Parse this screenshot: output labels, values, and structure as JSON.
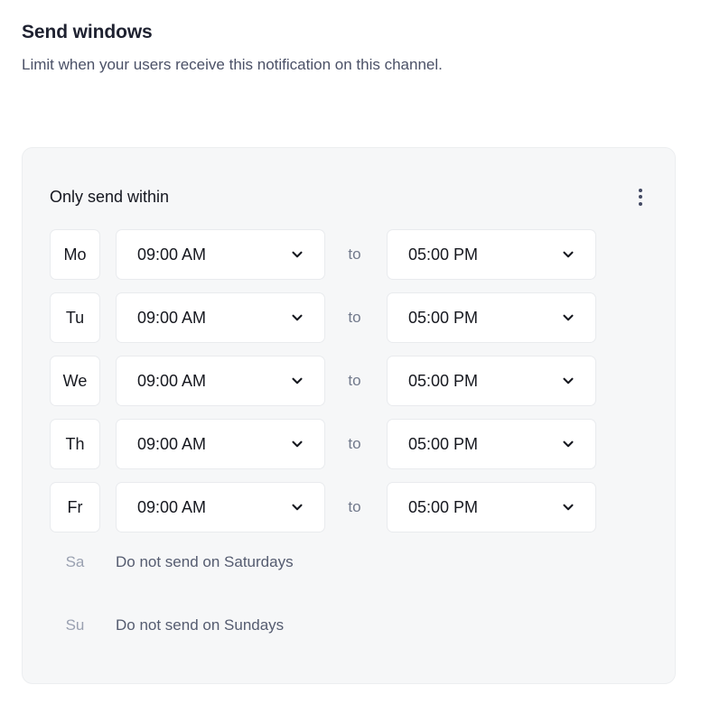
{
  "section": {
    "title": "Send windows",
    "description": "Limit when your users receive this notification on this channel."
  },
  "card": {
    "title": "Only send within",
    "menu_icon": "kebab-menu-icon",
    "to_label": "to",
    "chevron_icon": "chevron-down-icon",
    "schedule": [
      {
        "day": "Mo",
        "start": "09:00 AM",
        "end": "05:00 PM",
        "enabled": true
      },
      {
        "day": "Tu",
        "start": "09:00 AM",
        "end": "05:00 PM",
        "enabled": true
      },
      {
        "day": "We",
        "start": "09:00 AM",
        "end": "05:00 PM",
        "enabled": true
      },
      {
        "day": "Th",
        "start": "09:00 AM",
        "end": "05:00 PM",
        "enabled": true
      },
      {
        "day": "Fr",
        "start": "09:00 AM",
        "end": "05:00 PM",
        "enabled": true
      }
    ],
    "disabled_days": [
      {
        "day": "Sa",
        "message": "Do not send on Saturdays"
      },
      {
        "day": "Su",
        "message": "Do not send on Sundays"
      }
    ]
  },
  "colors": {
    "page_bg": "#ffffff",
    "card_bg": "#f6f7f8",
    "card_border": "#eceef0",
    "field_bg": "#ffffff",
    "field_border": "#e9ebee",
    "text_primary": "#16181f",
    "text_heading": "#1e2130",
    "text_secondary": "#4b5167",
    "text_muted": "#727a8c",
    "text_disabled": "#9aa1b1",
    "dot_color": "#434a63"
  }
}
